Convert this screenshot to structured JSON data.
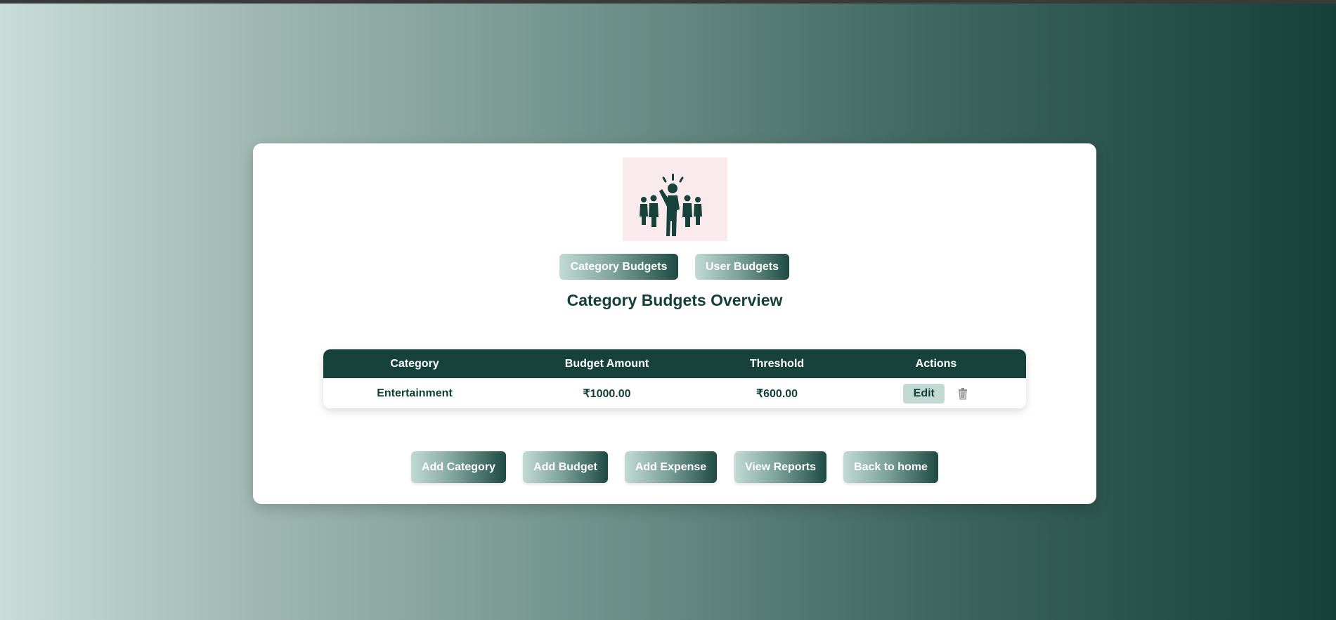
{
  "toggles": {
    "category_budgets": "Category Budgets",
    "user_budgets": "User Budgets"
  },
  "heading": "Category Budgets Overview",
  "table": {
    "headers": [
      "Category",
      "Budget Amount",
      "Threshold",
      "Actions"
    ],
    "rows": [
      {
        "category": "Entertainment",
        "budget": "₹1000.00",
        "threshold": "₹600.00",
        "edit": "Edit",
        "delete_icon": "trash-icon"
      }
    ]
  },
  "actions": [
    "Add Category",
    "Add Budget",
    "Add Expense",
    "View Reports",
    "Back to home"
  ],
  "logo_icon": "leader-group-icon",
  "colors": {
    "primary_dark": "#17423c",
    "light_accent": "#c3dad3",
    "logo_bg": "#f9ebed"
  }
}
